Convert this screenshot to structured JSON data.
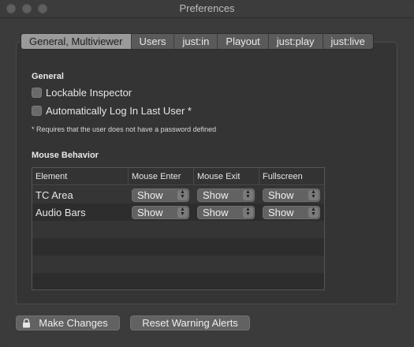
{
  "window": {
    "title": "Preferences"
  },
  "tabs": [
    {
      "label": "General, Multiviewer"
    },
    {
      "label": "Users"
    },
    {
      "label": "just:in"
    },
    {
      "label": "Playout"
    },
    {
      "label": "just:play"
    },
    {
      "label": "just:live"
    }
  ],
  "general": {
    "title": "General",
    "options": [
      {
        "label": "Lockable Inspector",
        "checked": false
      },
      {
        "label": "Automatically Log In Last User *",
        "checked": false
      }
    ],
    "footnote": "* Requires that the user does not have a password defined"
  },
  "mouse": {
    "title": "Mouse Behavior",
    "columns": [
      "Element",
      "Mouse Enter",
      "Mouse Exit",
      "Fullscreen"
    ],
    "rows": [
      {
        "element": "TC Area",
        "enter": "Show",
        "exit": "Show",
        "fullscreen": "Show"
      },
      {
        "element": "Audio Bars",
        "enter": "Show",
        "exit": "Show",
        "fullscreen": "Show"
      }
    ]
  },
  "buttons": {
    "make_changes": "Make Changes",
    "reset_alerts": "Reset Warning Alerts"
  },
  "colors": {
    "background": "#3b3b3b",
    "selected_tab": "#9a9a9a",
    "control": "#626262"
  }
}
